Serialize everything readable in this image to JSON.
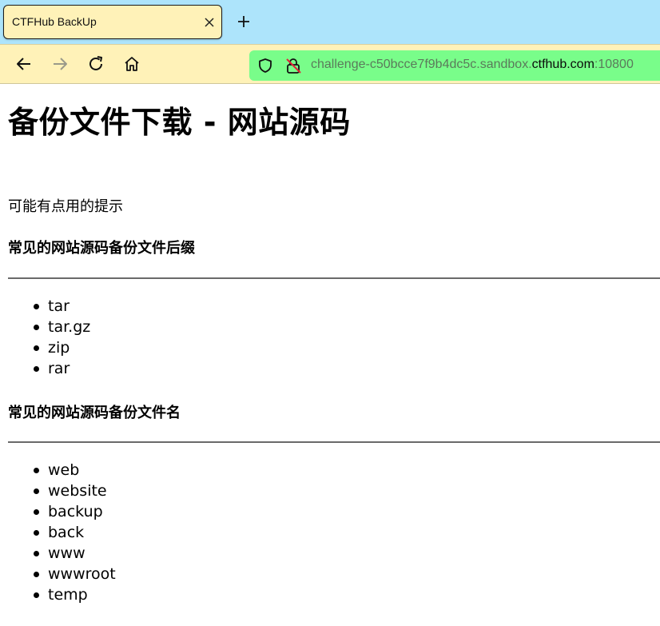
{
  "browser": {
    "tab": {
      "title": "CTFHub BackUp",
      "close_icon": "close-icon"
    },
    "new_tab_icon": "plus-icon",
    "nav": {
      "back_icon": "arrow-left-icon",
      "forward_icon": "arrow-right-icon",
      "reload_icon": "reload-icon",
      "home_icon": "home-icon"
    },
    "url": {
      "prefix": "challenge-c50bcce7f9b4dc5c.sandbox.",
      "domain": "ctfhub.com",
      "port": ":10800"
    },
    "colors": {
      "tabstrip": "#ade4fb",
      "toolbar": "#fff2b8",
      "urlbar": "#79fd8a"
    }
  },
  "page": {
    "title": "备份文件下载 - 网站源码",
    "hint": "可能有点用的提示",
    "sections": [
      {
        "heading": "常见的网站源码备份文件后缀",
        "items": [
          "tar",
          "tar.gz",
          "zip",
          "rar"
        ]
      },
      {
        "heading": "常见的网站源码备份文件名",
        "items": [
          "web",
          "website",
          "backup",
          "back",
          "www",
          "wwwroot",
          "temp"
        ]
      }
    ]
  }
}
